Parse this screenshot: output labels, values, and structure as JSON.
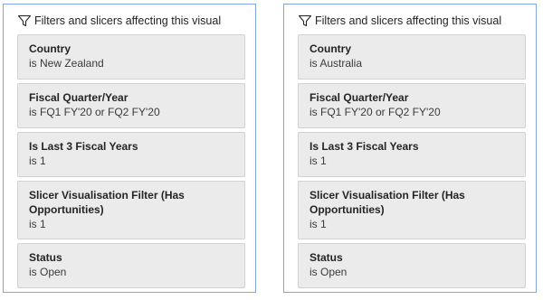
{
  "panels": [
    {
      "header": "Filters and slicers affecting this visual",
      "filters": [
        {
          "field": "Country",
          "value": "is New Zealand"
        },
        {
          "field": "Fiscal Quarter/Year",
          "value": "is FQ1 FY'20 or FQ2 FY'20"
        },
        {
          "field": "Is Last 3 Fiscal Years",
          "value": "is 1"
        },
        {
          "field": "Slicer Visualisation Filter (Has Opportunities)",
          "value": "is 1"
        },
        {
          "field": "Status",
          "value": "is Open"
        }
      ]
    },
    {
      "header": "Filters and slicers affecting this visual",
      "filters": [
        {
          "field": "Country",
          "value": "is Australia"
        },
        {
          "field": "Fiscal Quarter/Year",
          "value": "is FQ1 FY'20 or FQ2 FY'20"
        },
        {
          "field": "Is Last 3 Fiscal Years",
          "value": "is 1"
        },
        {
          "field": "Slicer Visualisation Filter (Has Opportunities)",
          "value": "is 1"
        },
        {
          "field": "Status",
          "value": "is Open"
        }
      ]
    }
  ],
  "colors": {
    "panel_border": "#7fa7dd",
    "card_background": "#ebebeb",
    "text": "#252423"
  },
  "icons": {
    "header_icon": "filter-icon"
  }
}
